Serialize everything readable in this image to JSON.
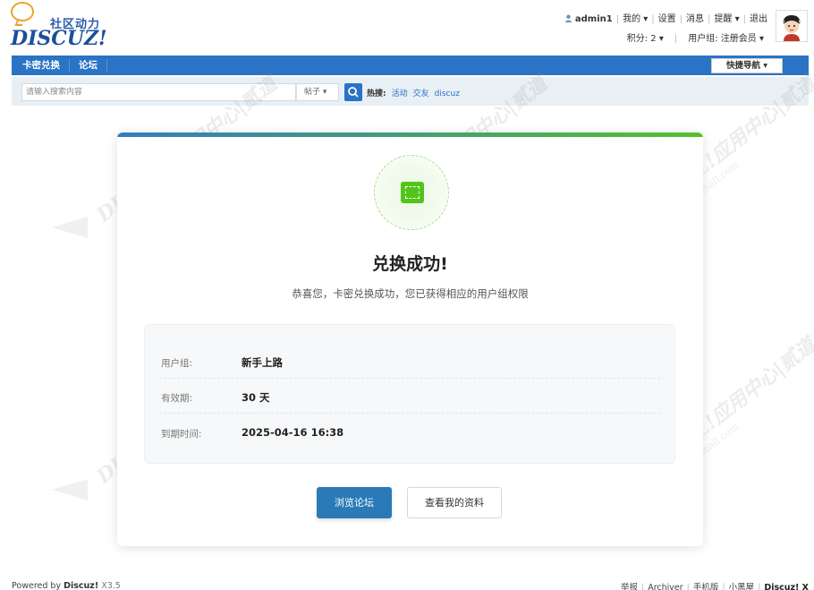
{
  "logo": {
    "cn": "社区动力",
    "en": "DISCUZ!"
  },
  "user": {
    "name": "admin1",
    "links": [
      "我的",
      "设置",
      "消息",
      "提醒",
      "退出"
    ],
    "credits": "积分: 2",
    "group": "用户组: 注册会员"
  },
  "nav": {
    "items": [
      "卡密兑换",
      "论坛"
    ],
    "quick_nav": "快捷导航"
  },
  "search": {
    "placeholder": "请输入搜索内容",
    "type": "帖子",
    "hot_label": "热搜:",
    "hot_items": [
      "活动",
      "交友",
      "discuz"
    ]
  },
  "card": {
    "title": "兑换成功!",
    "subtitle": "恭喜您，卡密兑换成功，您已获得相应的用户组权限",
    "rows": [
      {
        "label": "用户组:",
        "value": "新手上路"
      },
      {
        "label": "有效期:",
        "value": "30 天"
      },
      {
        "label": "到期时间:",
        "value": "2025-04-16 16:38"
      }
    ],
    "btn_primary": "浏览论坛",
    "btn_default": "查看我的资料"
  },
  "footer": {
    "powered": "Powered by",
    "brand": "Discuz!",
    "version": "X3.5",
    "links": [
      "举报",
      "Archiver",
      "手机版",
      "小黑屋"
    ],
    "right_brand": "Discuz! X"
  },
  "colors": {
    "accent": "#2a73c5",
    "success": "#52c41a"
  }
}
